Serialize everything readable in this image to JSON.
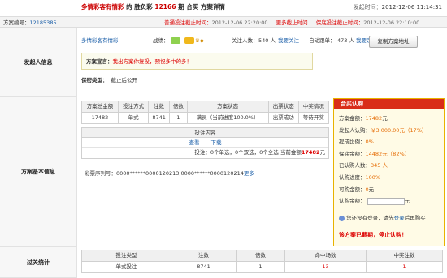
{
  "header": {
    "title_game": "多情彩客有情彩",
    "title_mid": "的 胜负彩",
    "title_issue": "12166",
    "title_end": "期 合买 方案详情",
    "publish_label": "发起时间：",
    "publish_time": "2012-12-06 11:14:31"
  },
  "scheme_bar": {
    "id_label": "方案编号：",
    "id_value": "12185385",
    "normal_deadline_label": "普通投注截止时间：",
    "normal_deadline": "2012-12-06 22:20:00",
    "more_label": "更多截止时间",
    "guarantee_label": "保底投注截止时间：",
    "guarantee_deadline": "2012-12-06 22:10:00"
  },
  "initiator": {
    "section_label": "发起人信息",
    "name": "多情彩客有情彩",
    "record_label": "战绩：",
    "fans_label": "关注人数：",
    "fans_count": "540 人",
    "follow_link": "我要关注",
    "auto_label": "自动跟单：",
    "auto_count": "473 人",
    "customize_link": "我要定制",
    "copy_button": "复制方案地址",
    "declaration_label": "方案宣言：",
    "declaration": "我出方案你复投，预祝多中的多！",
    "secrecy_label": "保密类型：",
    "secrecy_value": "截止后公开"
  },
  "scheme": {
    "section_label": "方案基本信息",
    "table_headers": [
      "方案总金额",
      "投注方式",
      "注数",
      "倍数",
      "方案状态",
      "出票状态",
      "中奖情况"
    ],
    "table_row": [
      "17482",
      "单式",
      "8741",
      "1",
      "满员（当前进度100.0%）",
      "出票成功",
      "等待开奖"
    ],
    "content_header": "投注内容",
    "view_link": "查看",
    "download_link": "下载",
    "summary_prefix": "投注：",
    "summary_text": "0个单选，0个双选，0个全选 当前金额",
    "summary_amount": "17482",
    "summary_unit": "元",
    "serial_label": "彩票序列号：",
    "serial_value": "0000******0000120213,0000******0000120214",
    "serial_more": "更多"
  },
  "buy_panel": {
    "title": "合买认购",
    "rows": [
      {
        "label": "方案金额：",
        "value": "17482",
        "unit": "元"
      },
      {
        "label": "发起人认购：",
        "value": "￥3,000.00元（17%）",
        "unit": ""
      },
      {
        "label": "提成比例：",
        "value": "0%",
        "unit": ""
      },
      {
        "label": "保底金额：",
        "value": "14482元（82%）",
        "unit": ""
      },
      {
        "label": "已认购人数：",
        "value": "345 人",
        "unit": ""
      },
      {
        "label": "认购进度：",
        "value": "100%",
        "unit": ""
      },
      {
        "label": "可购金额：",
        "value": "0",
        "unit": "元"
      },
      {
        "label": "认购金额：",
        "value": "",
        "unit": "元"
      }
    ],
    "login_prefix": "您还没有登录，请先",
    "login_link": "登录",
    "login_suffix": "后再购买",
    "stop_notice": "该方案已截期，停止认购！"
  },
  "pass_stats": {
    "section_label": "过关统计",
    "headers": [
      "投注类型",
      "注数",
      "倍数",
      "命中场数",
      "中奖注数"
    ],
    "row": [
      "单式投注",
      "8741",
      "1",
      "13",
      "1"
    ]
  },
  "colors": {
    "accent_red": "#d92d18",
    "link_blue": "#1a5ea8",
    "orange": "#e56a00"
  }
}
